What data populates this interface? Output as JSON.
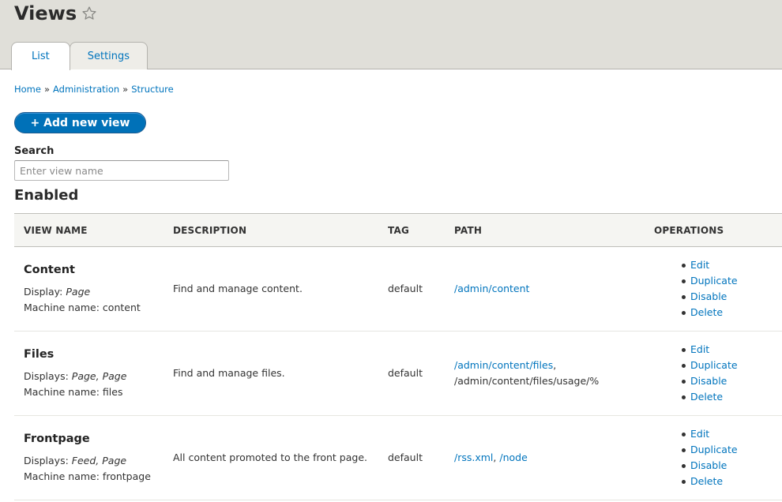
{
  "header": {
    "title": "Views"
  },
  "tabs": [
    {
      "label": "List"
    },
    {
      "label": "Settings"
    }
  ],
  "breadcrumb": [
    "Home",
    "Administration",
    "Structure"
  ],
  "breadcrumb_separator": "»",
  "add_button": {
    "label": "+ Add new view"
  },
  "search": {
    "label": "Search",
    "placeholder": "Enter view name"
  },
  "section": {
    "title": "Enabled"
  },
  "table": {
    "headers": [
      "View name",
      "Description",
      "Tag",
      "Path",
      "Operations"
    ],
    "rows": [
      {
        "name": "Content",
        "display_label": "Display:",
        "display_values": "Page",
        "machine_name": "Machine name: content",
        "description": "Find and manage content.",
        "tag": "default",
        "paths": [
          "/admin/content"
        ],
        "path_plain": ""
      },
      {
        "name": "Files",
        "display_label": "Displays:",
        "display_values": "Page, Page",
        "machine_name": "Machine name: files",
        "description": "Find and manage files.",
        "tag": "default",
        "paths": [
          "/admin/content/files"
        ],
        "path_plain": "/admin/content/files/usage/%"
      },
      {
        "name": "Frontpage",
        "display_label": "Displays:",
        "display_values": "Feed, Page",
        "machine_name": "Machine name: frontpage",
        "description": "All content promoted to the front page.",
        "tag": "default",
        "paths": [
          "/rss.xml",
          "/node"
        ],
        "path_plain": ""
      }
    ],
    "operations": [
      "Edit",
      "Duplicate",
      "Disable",
      "Delete"
    ]
  },
  "icons": {
    "title_star": "star-outline-icon"
  },
  "colors": {
    "link": "#0074bd",
    "button": "#0071b8",
    "header_bg": "#e0dfd9"
  }
}
